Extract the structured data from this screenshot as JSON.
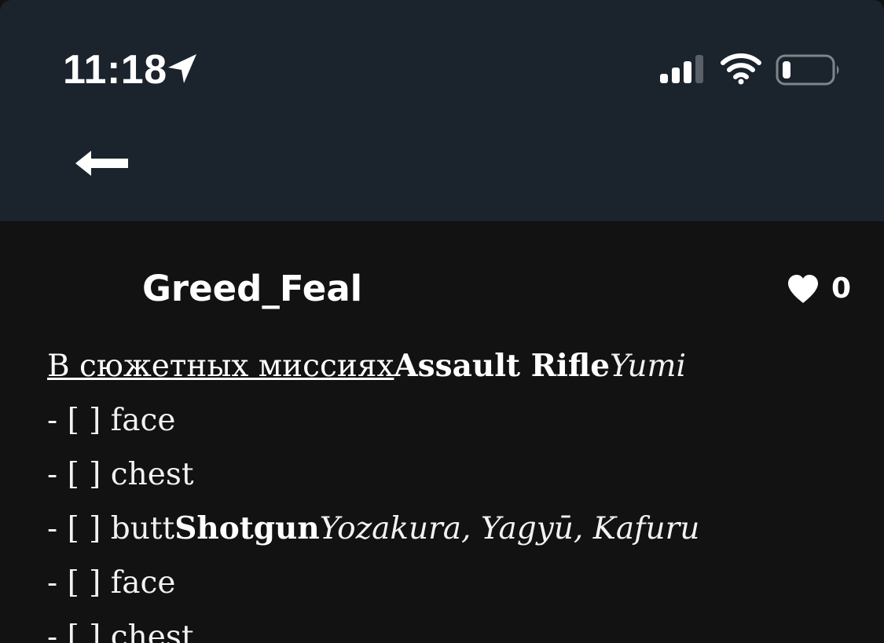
{
  "status_bar": {
    "time": "11:18",
    "icons": [
      "location-arrow-icon",
      "cellular-signal-icon",
      "wifi-icon",
      "battery-low-icon"
    ]
  },
  "nav": {
    "back_icon": "arrow-left-icon"
  },
  "post": {
    "author": "Greed_Feal",
    "like_count": "0",
    "heart_icon": "heart-icon",
    "lines": [
      {
        "link": "В сюжетных миссиях",
        "bold": "Assault Rifle",
        "italic": "Yumi"
      },
      {
        "text": "- [ ] face"
      },
      {
        "text": "- [ ] chest"
      },
      {
        "text": "- [ ] butt",
        "bold": "Shotgun",
        "italic": "Yozakura, Yagyū, Kafuru"
      },
      {
        "text": "- [ ] face"
      },
      {
        "text": "- [ ] chest"
      }
    ]
  },
  "colors": {
    "header_bg": "#1b232c",
    "content_bg": "#121212",
    "text": "#ffffff"
  }
}
